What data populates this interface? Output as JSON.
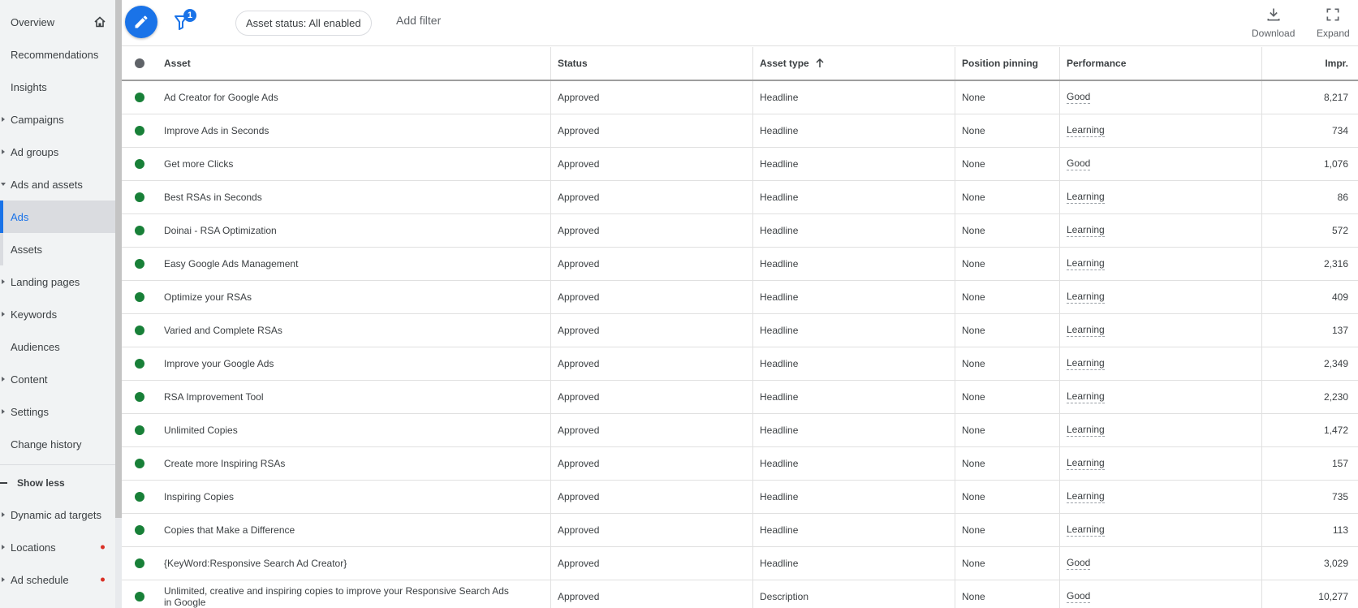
{
  "sidebar": {
    "items": [
      {
        "label": "Overview",
        "caret": "none",
        "icon": "home-icon"
      },
      {
        "label": "Recommendations",
        "caret": "none"
      },
      {
        "label": "Insights",
        "caret": "none"
      },
      {
        "label": "Campaigns",
        "caret": "right"
      },
      {
        "label": "Ad groups",
        "caret": "right"
      },
      {
        "label": "Ads and assets",
        "caret": "down"
      },
      {
        "label": "Ads",
        "caret": "none",
        "active": true
      },
      {
        "label": "Assets",
        "caret": "none"
      },
      {
        "label": "Landing pages",
        "caret": "right"
      },
      {
        "label": "Keywords",
        "caret": "right"
      },
      {
        "label": "Audiences",
        "caret": "none"
      },
      {
        "label": "Content",
        "caret": "right"
      },
      {
        "label": "Settings",
        "caret": "right"
      },
      {
        "label": "Change history",
        "caret": "none"
      }
    ],
    "show_less": "Show less",
    "extra_items": [
      {
        "label": "Dynamic ad targets",
        "caret": "right",
        "alert": false
      },
      {
        "label": "Locations",
        "caret": "right",
        "alert": true
      },
      {
        "label": "Ad schedule",
        "caret": "right",
        "alert": true
      }
    ]
  },
  "toolbar": {
    "filter_badge": "1",
    "status_chip": "Asset status: All enabled",
    "add_filter": "Add filter",
    "download_label": "Download",
    "expand_label": "Expand"
  },
  "colors": {
    "accent": "#1a73e8",
    "status_approved": "#188038",
    "alert": "#d93025"
  },
  "table": {
    "columns": {
      "asset": "Asset",
      "status": "Status",
      "asset_type": "Asset type",
      "position_pinning": "Position pinning",
      "performance": "Performance",
      "impr": "Impr."
    },
    "rows": [
      {
        "asset": "Ad Creator for Google Ads",
        "status": "Approved",
        "type": "Headline",
        "pinning": "None",
        "performance": "Good",
        "impr": "8,217"
      },
      {
        "asset": "Improve Ads in Seconds",
        "status": "Approved",
        "type": "Headline",
        "pinning": "None",
        "performance": "Learning",
        "impr": "734"
      },
      {
        "asset": "Get more Clicks",
        "status": "Approved",
        "type": "Headline",
        "pinning": "None",
        "performance": "Good",
        "impr": "1,076"
      },
      {
        "asset": "Best RSAs in Seconds",
        "status": "Approved",
        "type": "Headline",
        "pinning": "None",
        "performance": "Learning",
        "impr": "86"
      },
      {
        "asset": "Doinai - RSA Optimization",
        "status": "Approved",
        "type": "Headline",
        "pinning": "None",
        "performance": "Learning",
        "impr": "572"
      },
      {
        "asset": "Easy Google Ads Management",
        "status": "Approved",
        "type": "Headline",
        "pinning": "None",
        "performance": "Learning",
        "impr": "2,316"
      },
      {
        "asset": "Optimize your RSAs",
        "status": "Approved",
        "type": "Headline",
        "pinning": "None",
        "performance": "Learning",
        "impr": "409"
      },
      {
        "asset": "Varied and Complete RSAs",
        "status": "Approved",
        "type": "Headline",
        "pinning": "None",
        "performance": "Learning",
        "impr": "137"
      },
      {
        "asset": "Improve your Google Ads",
        "status": "Approved",
        "type": "Headline",
        "pinning": "None",
        "performance": "Learning",
        "impr": "2,349"
      },
      {
        "asset": "RSA Improvement Tool",
        "status": "Approved",
        "type": "Headline",
        "pinning": "None",
        "performance": "Learning",
        "impr": "2,230"
      },
      {
        "asset": "Unlimited Copies",
        "status": "Approved",
        "type": "Headline",
        "pinning": "None",
        "performance": "Learning",
        "impr": "1,472"
      },
      {
        "asset": "Create more Inspiring RSAs",
        "status": "Approved",
        "type": "Headline",
        "pinning": "None",
        "performance": "Learning",
        "impr": "157"
      },
      {
        "asset": "Inspiring Copies",
        "status": "Approved",
        "type": "Headline",
        "pinning": "None",
        "performance": "Learning",
        "impr": "735"
      },
      {
        "asset": "Copies that Make a Difference",
        "status": "Approved",
        "type": "Headline",
        "pinning": "None",
        "performance": "Learning",
        "impr": "113"
      },
      {
        "asset": "{KeyWord:Responsive Search Ad Creator}",
        "status": "Approved",
        "type": "Headline",
        "pinning": "None",
        "performance": "Good",
        "impr": "3,029"
      },
      {
        "asset": "Unlimited, creative and inspiring copies to improve your Responsive Search Ads in Google",
        "status": "Approved",
        "type": "Description",
        "pinning": "None",
        "performance": "Good",
        "impr": "10,277"
      }
    ]
  }
}
